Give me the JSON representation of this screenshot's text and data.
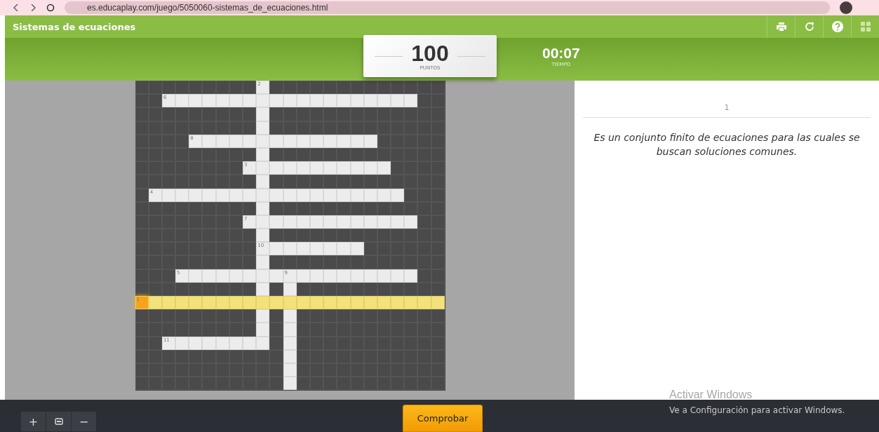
{
  "browser": {
    "url": "es.educaplay.com/juego/5050060-sistemas_de_ecuaciones.html"
  },
  "header": {
    "title": "Sistemas de ecuaciones"
  },
  "score": {
    "value": "100",
    "label": "PUNTOS"
  },
  "timer": {
    "value": "00:07",
    "label": "TIEMPO"
  },
  "grid": {
    "rows": [
      {
        "highlighted": false,
        "cells": [
          {
            "kind": "block"
          },
          {
            "kind": "block"
          },
          {
            "kind": "block"
          },
          {
            "kind": "block"
          },
          {
            "kind": "block"
          },
          {
            "kind": "block"
          },
          {
            "kind": "block"
          },
          {
            "kind": "block"
          },
          {
            "kind": "block"
          },
          {
            "kind": "numbered",
            "number": "2"
          },
          {
            "kind": "block"
          },
          {
            "kind": "block"
          },
          {
            "kind": "block"
          },
          {
            "kind": "block"
          },
          {
            "kind": "block"
          },
          {
            "kind": "block"
          },
          {
            "kind": "block"
          },
          {
            "kind": "block"
          },
          {
            "kind": "block"
          },
          {
            "kind": "block"
          },
          {
            "kind": "block"
          },
          {
            "kind": "block"
          },
          {
            "kind": "block"
          }
        ]
      },
      {
        "highlighted": false,
        "cells": [
          {
            "kind": "block"
          },
          {
            "kind": "block"
          },
          {
            "kind": "numbered",
            "number": "6"
          },
          {
            "kind": "open"
          },
          {
            "kind": "open"
          },
          {
            "kind": "open"
          },
          {
            "kind": "open"
          },
          {
            "kind": "open"
          },
          {
            "kind": "open"
          },
          {
            "kind": "open"
          },
          {
            "kind": "open"
          },
          {
            "kind": "open"
          },
          {
            "kind": "open"
          },
          {
            "kind": "open"
          },
          {
            "kind": "open"
          },
          {
            "kind": "open"
          },
          {
            "kind": "open"
          },
          {
            "kind": "open"
          },
          {
            "kind": "open"
          },
          {
            "kind": "open"
          },
          {
            "kind": "open"
          },
          {
            "kind": "block"
          },
          {
            "kind": "block"
          }
        ]
      },
      {
        "highlighted": false,
        "cells": [
          {
            "kind": "block"
          },
          {
            "kind": "block"
          },
          {
            "kind": "block"
          },
          {
            "kind": "block"
          },
          {
            "kind": "block"
          },
          {
            "kind": "block"
          },
          {
            "kind": "block"
          },
          {
            "kind": "block"
          },
          {
            "kind": "block"
          },
          {
            "kind": "open"
          },
          {
            "kind": "block"
          },
          {
            "kind": "block"
          },
          {
            "kind": "block"
          },
          {
            "kind": "block"
          },
          {
            "kind": "block"
          },
          {
            "kind": "block"
          },
          {
            "kind": "block"
          },
          {
            "kind": "block"
          },
          {
            "kind": "block"
          },
          {
            "kind": "block"
          },
          {
            "kind": "block"
          },
          {
            "kind": "block"
          },
          {
            "kind": "block"
          }
        ]
      },
      {
        "highlighted": false,
        "cells": [
          {
            "kind": "block"
          },
          {
            "kind": "block"
          },
          {
            "kind": "block"
          },
          {
            "kind": "block"
          },
          {
            "kind": "block"
          },
          {
            "kind": "block"
          },
          {
            "kind": "block"
          },
          {
            "kind": "block"
          },
          {
            "kind": "block"
          },
          {
            "kind": "open"
          },
          {
            "kind": "block"
          },
          {
            "kind": "block"
          },
          {
            "kind": "block"
          },
          {
            "kind": "block"
          },
          {
            "kind": "block"
          },
          {
            "kind": "block"
          },
          {
            "kind": "block"
          },
          {
            "kind": "block"
          },
          {
            "kind": "block"
          },
          {
            "kind": "block"
          },
          {
            "kind": "block"
          },
          {
            "kind": "block"
          },
          {
            "kind": "block"
          }
        ]
      },
      {
        "highlighted": false,
        "cells": [
          {
            "kind": "block"
          },
          {
            "kind": "block"
          },
          {
            "kind": "block"
          },
          {
            "kind": "block"
          },
          {
            "kind": "numbered",
            "number": "8"
          },
          {
            "kind": "open"
          },
          {
            "kind": "open"
          },
          {
            "kind": "open"
          },
          {
            "kind": "open"
          },
          {
            "kind": "open"
          },
          {
            "kind": "open"
          },
          {
            "kind": "open"
          },
          {
            "kind": "open"
          },
          {
            "kind": "open"
          },
          {
            "kind": "open"
          },
          {
            "kind": "open"
          },
          {
            "kind": "open"
          },
          {
            "kind": "open"
          },
          {
            "kind": "block"
          },
          {
            "kind": "block"
          },
          {
            "kind": "block"
          },
          {
            "kind": "block"
          },
          {
            "kind": "block"
          }
        ]
      },
      {
        "highlighted": false,
        "cells": [
          {
            "kind": "block"
          },
          {
            "kind": "block"
          },
          {
            "kind": "block"
          },
          {
            "kind": "block"
          },
          {
            "kind": "block"
          },
          {
            "kind": "block"
          },
          {
            "kind": "block"
          },
          {
            "kind": "block"
          },
          {
            "kind": "block"
          },
          {
            "kind": "open"
          },
          {
            "kind": "block"
          },
          {
            "kind": "block"
          },
          {
            "kind": "block"
          },
          {
            "kind": "block"
          },
          {
            "kind": "block"
          },
          {
            "kind": "block"
          },
          {
            "kind": "block"
          },
          {
            "kind": "block"
          },
          {
            "kind": "block"
          },
          {
            "kind": "block"
          },
          {
            "kind": "block"
          },
          {
            "kind": "block"
          },
          {
            "kind": "block"
          }
        ]
      },
      {
        "highlighted": false,
        "cells": [
          {
            "kind": "block"
          },
          {
            "kind": "block"
          },
          {
            "kind": "block"
          },
          {
            "kind": "block"
          },
          {
            "kind": "block"
          },
          {
            "kind": "block"
          },
          {
            "kind": "block"
          },
          {
            "kind": "block"
          },
          {
            "kind": "numbered",
            "number": "3"
          },
          {
            "kind": "open"
          },
          {
            "kind": "open"
          },
          {
            "kind": "open"
          },
          {
            "kind": "open"
          },
          {
            "kind": "open"
          },
          {
            "kind": "open"
          },
          {
            "kind": "open"
          },
          {
            "kind": "open"
          },
          {
            "kind": "open"
          },
          {
            "kind": "open"
          },
          {
            "kind": "block"
          },
          {
            "kind": "block"
          },
          {
            "kind": "block"
          },
          {
            "kind": "block"
          }
        ]
      },
      {
        "highlighted": false,
        "cells": [
          {
            "kind": "block"
          },
          {
            "kind": "block"
          },
          {
            "kind": "block"
          },
          {
            "kind": "block"
          },
          {
            "kind": "block"
          },
          {
            "kind": "block"
          },
          {
            "kind": "block"
          },
          {
            "kind": "block"
          },
          {
            "kind": "block"
          },
          {
            "kind": "open"
          },
          {
            "kind": "block"
          },
          {
            "kind": "block"
          },
          {
            "kind": "block"
          },
          {
            "kind": "block"
          },
          {
            "kind": "block"
          },
          {
            "kind": "block"
          },
          {
            "kind": "block"
          },
          {
            "kind": "block"
          },
          {
            "kind": "block"
          },
          {
            "kind": "block"
          },
          {
            "kind": "block"
          },
          {
            "kind": "block"
          },
          {
            "kind": "block"
          }
        ]
      },
      {
        "highlighted": false,
        "cells": [
          {
            "kind": "block"
          },
          {
            "kind": "numbered",
            "number": "4"
          },
          {
            "kind": "open"
          },
          {
            "kind": "open"
          },
          {
            "kind": "open"
          },
          {
            "kind": "open"
          },
          {
            "kind": "open"
          },
          {
            "kind": "open"
          },
          {
            "kind": "open"
          },
          {
            "kind": "open"
          },
          {
            "kind": "open"
          },
          {
            "kind": "open"
          },
          {
            "kind": "open"
          },
          {
            "kind": "open"
          },
          {
            "kind": "open"
          },
          {
            "kind": "open"
          },
          {
            "kind": "open"
          },
          {
            "kind": "open"
          },
          {
            "kind": "open"
          },
          {
            "kind": "open"
          },
          {
            "kind": "block"
          },
          {
            "kind": "block"
          },
          {
            "kind": "block"
          }
        ]
      },
      {
        "highlighted": false,
        "cells": [
          {
            "kind": "block"
          },
          {
            "kind": "block"
          },
          {
            "kind": "block"
          },
          {
            "kind": "block"
          },
          {
            "kind": "block"
          },
          {
            "kind": "block"
          },
          {
            "kind": "block"
          },
          {
            "kind": "block"
          },
          {
            "kind": "block"
          },
          {
            "kind": "open"
          },
          {
            "kind": "block"
          },
          {
            "kind": "block"
          },
          {
            "kind": "block"
          },
          {
            "kind": "block"
          },
          {
            "kind": "block"
          },
          {
            "kind": "block"
          },
          {
            "kind": "block"
          },
          {
            "kind": "block"
          },
          {
            "kind": "block"
          },
          {
            "kind": "block"
          },
          {
            "kind": "block"
          },
          {
            "kind": "block"
          },
          {
            "kind": "block"
          }
        ]
      },
      {
        "highlighted": false,
        "cells": [
          {
            "kind": "block"
          },
          {
            "kind": "block"
          },
          {
            "kind": "block"
          },
          {
            "kind": "block"
          },
          {
            "kind": "block"
          },
          {
            "kind": "block"
          },
          {
            "kind": "block"
          },
          {
            "kind": "block"
          },
          {
            "kind": "numbered",
            "number": "7"
          },
          {
            "kind": "open"
          },
          {
            "kind": "open"
          },
          {
            "kind": "open"
          },
          {
            "kind": "open"
          },
          {
            "kind": "open"
          },
          {
            "kind": "open"
          },
          {
            "kind": "open"
          },
          {
            "kind": "open"
          },
          {
            "kind": "open"
          },
          {
            "kind": "open"
          },
          {
            "kind": "open"
          },
          {
            "kind": "open"
          },
          {
            "kind": "block"
          },
          {
            "kind": "block"
          }
        ]
      },
      {
        "highlighted": false,
        "cells": [
          {
            "kind": "block"
          },
          {
            "kind": "block"
          },
          {
            "kind": "block"
          },
          {
            "kind": "block"
          },
          {
            "kind": "block"
          },
          {
            "kind": "block"
          },
          {
            "kind": "block"
          },
          {
            "kind": "block"
          },
          {
            "kind": "block"
          },
          {
            "kind": "open"
          },
          {
            "kind": "block"
          },
          {
            "kind": "block"
          },
          {
            "kind": "block"
          },
          {
            "kind": "block"
          },
          {
            "kind": "block"
          },
          {
            "kind": "block"
          },
          {
            "kind": "block"
          },
          {
            "kind": "block"
          },
          {
            "kind": "block"
          },
          {
            "kind": "block"
          },
          {
            "kind": "block"
          },
          {
            "kind": "block"
          },
          {
            "kind": "block"
          }
        ]
      },
      {
        "highlighted": false,
        "cells": [
          {
            "kind": "block"
          },
          {
            "kind": "block"
          },
          {
            "kind": "block"
          },
          {
            "kind": "block"
          },
          {
            "kind": "block"
          },
          {
            "kind": "block"
          },
          {
            "kind": "block"
          },
          {
            "kind": "block"
          },
          {
            "kind": "block"
          },
          {
            "kind": "numbered",
            "number": "10"
          },
          {
            "kind": "open"
          },
          {
            "kind": "open"
          },
          {
            "kind": "open"
          },
          {
            "kind": "open"
          },
          {
            "kind": "open"
          },
          {
            "kind": "open"
          },
          {
            "kind": "open"
          },
          {
            "kind": "block"
          },
          {
            "kind": "block"
          },
          {
            "kind": "block"
          },
          {
            "kind": "block"
          },
          {
            "kind": "block"
          },
          {
            "kind": "block"
          }
        ]
      },
      {
        "highlighted": false,
        "cells": [
          {
            "kind": "block"
          },
          {
            "kind": "block"
          },
          {
            "kind": "block"
          },
          {
            "kind": "block"
          },
          {
            "kind": "block"
          },
          {
            "kind": "block"
          },
          {
            "kind": "block"
          },
          {
            "kind": "block"
          },
          {
            "kind": "block"
          },
          {
            "kind": "open"
          },
          {
            "kind": "block"
          },
          {
            "kind": "block"
          },
          {
            "kind": "block"
          },
          {
            "kind": "block"
          },
          {
            "kind": "block"
          },
          {
            "kind": "block"
          },
          {
            "kind": "block"
          },
          {
            "kind": "block"
          },
          {
            "kind": "block"
          },
          {
            "kind": "block"
          },
          {
            "kind": "block"
          },
          {
            "kind": "block"
          },
          {
            "kind": "block"
          }
        ]
      },
      {
        "highlighted": false,
        "cells": [
          {
            "kind": "block"
          },
          {
            "kind": "block"
          },
          {
            "kind": "block"
          },
          {
            "kind": "numbered",
            "number": "5"
          },
          {
            "kind": "open"
          },
          {
            "kind": "open"
          },
          {
            "kind": "open"
          },
          {
            "kind": "open"
          },
          {
            "kind": "open"
          },
          {
            "kind": "open"
          },
          {
            "kind": "open"
          },
          {
            "kind": "numbered",
            "number": "9"
          },
          {
            "kind": "open"
          },
          {
            "kind": "open"
          },
          {
            "kind": "open"
          },
          {
            "kind": "open"
          },
          {
            "kind": "open"
          },
          {
            "kind": "open"
          },
          {
            "kind": "open"
          },
          {
            "kind": "open"
          },
          {
            "kind": "open"
          },
          {
            "kind": "block"
          },
          {
            "kind": "block"
          }
        ]
      },
      {
        "highlighted": false,
        "cells": [
          {
            "kind": "block"
          },
          {
            "kind": "block"
          },
          {
            "kind": "block"
          },
          {
            "kind": "block"
          },
          {
            "kind": "block"
          },
          {
            "kind": "block"
          },
          {
            "kind": "block"
          },
          {
            "kind": "block"
          },
          {
            "kind": "block"
          },
          {
            "kind": "open"
          },
          {
            "kind": "block"
          },
          {
            "kind": "open"
          },
          {
            "kind": "block"
          },
          {
            "kind": "block"
          },
          {
            "kind": "block"
          },
          {
            "kind": "block"
          },
          {
            "kind": "block"
          },
          {
            "kind": "block"
          },
          {
            "kind": "block"
          },
          {
            "kind": "block"
          },
          {
            "kind": "block"
          },
          {
            "kind": "block"
          },
          {
            "kind": "block"
          }
        ]
      },
      {
        "highlighted": true,
        "cells": [
          {
            "kind": "active",
            "number": "1"
          },
          {
            "kind": "open"
          },
          {
            "kind": "open"
          },
          {
            "kind": "open"
          },
          {
            "kind": "open"
          },
          {
            "kind": "open"
          },
          {
            "kind": "open"
          },
          {
            "kind": "open"
          },
          {
            "kind": "open"
          },
          {
            "kind": "open"
          },
          {
            "kind": "open"
          },
          {
            "kind": "open"
          },
          {
            "kind": "open"
          },
          {
            "kind": "open"
          },
          {
            "kind": "open"
          },
          {
            "kind": "open"
          },
          {
            "kind": "open"
          },
          {
            "kind": "open"
          },
          {
            "kind": "open"
          },
          {
            "kind": "open"
          },
          {
            "kind": "open"
          },
          {
            "kind": "open"
          },
          {
            "kind": "open"
          }
        ]
      },
      {
        "highlighted": false,
        "cells": [
          {
            "kind": "block"
          },
          {
            "kind": "block"
          },
          {
            "kind": "block"
          },
          {
            "kind": "block"
          },
          {
            "kind": "block"
          },
          {
            "kind": "block"
          },
          {
            "kind": "block"
          },
          {
            "kind": "block"
          },
          {
            "kind": "block"
          },
          {
            "kind": "open"
          },
          {
            "kind": "block"
          },
          {
            "kind": "open"
          },
          {
            "kind": "block"
          },
          {
            "kind": "block"
          },
          {
            "kind": "block"
          },
          {
            "kind": "block"
          },
          {
            "kind": "block"
          },
          {
            "kind": "block"
          },
          {
            "kind": "block"
          },
          {
            "kind": "block"
          },
          {
            "kind": "block"
          },
          {
            "kind": "block"
          },
          {
            "kind": "block"
          }
        ]
      },
      {
        "highlighted": false,
        "cells": [
          {
            "kind": "block"
          },
          {
            "kind": "block"
          },
          {
            "kind": "block"
          },
          {
            "kind": "block"
          },
          {
            "kind": "block"
          },
          {
            "kind": "block"
          },
          {
            "kind": "block"
          },
          {
            "kind": "block"
          },
          {
            "kind": "block"
          },
          {
            "kind": "open"
          },
          {
            "kind": "block"
          },
          {
            "kind": "open"
          },
          {
            "kind": "block"
          },
          {
            "kind": "block"
          },
          {
            "kind": "block"
          },
          {
            "kind": "block"
          },
          {
            "kind": "block"
          },
          {
            "kind": "block"
          },
          {
            "kind": "block"
          },
          {
            "kind": "block"
          },
          {
            "kind": "block"
          },
          {
            "kind": "block"
          },
          {
            "kind": "block"
          }
        ]
      },
      {
        "highlighted": false,
        "cells": [
          {
            "kind": "block"
          },
          {
            "kind": "block"
          },
          {
            "kind": "numbered",
            "number": "11"
          },
          {
            "kind": "open"
          },
          {
            "kind": "open"
          },
          {
            "kind": "open"
          },
          {
            "kind": "open"
          },
          {
            "kind": "open"
          },
          {
            "kind": "open"
          },
          {
            "kind": "open"
          },
          {
            "kind": "block"
          },
          {
            "kind": "open"
          },
          {
            "kind": "block"
          },
          {
            "kind": "block"
          },
          {
            "kind": "block"
          },
          {
            "kind": "block"
          },
          {
            "kind": "block"
          },
          {
            "kind": "block"
          },
          {
            "kind": "block"
          },
          {
            "kind": "block"
          },
          {
            "kind": "block"
          },
          {
            "kind": "block"
          },
          {
            "kind": "block"
          }
        ]
      },
      {
        "highlighted": false,
        "cells": [
          {
            "kind": "block"
          },
          {
            "kind": "block"
          },
          {
            "kind": "block"
          },
          {
            "kind": "block"
          },
          {
            "kind": "block"
          },
          {
            "kind": "block"
          },
          {
            "kind": "block"
          },
          {
            "kind": "block"
          },
          {
            "kind": "block"
          },
          {
            "kind": "block"
          },
          {
            "kind": "block"
          },
          {
            "kind": "open"
          },
          {
            "kind": "block"
          },
          {
            "kind": "block"
          },
          {
            "kind": "block"
          },
          {
            "kind": "block"
          },
          {
            "kind": "block"
          },
          {
            "kind": "block"
          },
          {
            "kind": "block"
          },
          {
            "kind": "block"
          },
          {
            "kind": "block"
          },
          {
            "kind": "block"
          },
          {
            "kind": "block"
          }
        ]
      },
      {
        "highlighted": false,
        "cells": [
          {
            "kind": "block"
          },
          {
            "kind": "block"
          },
          {
            "kind": "block"
          },
          {
            "kind": "block"
          },
          {
            "kind": "block"
          },
          {
            "kind": "block"
          },
          {
            "kind": "block"
          },
          {
            "kind": "block"
          },
          {
            "kind": "block"
          },
          {
            "kind": "block"
          },
          {
            "kind": "block"
          },
          {
            "kind": "open"
          },
          {
            "kind": "block"
          },
          {
            "kind": "block"
          },
          {
            "kind": "block"
          },
          {
            "kind": "block"
          },
          {
            "kind": "block"
          },
          {
            "kind": "block"
          },
          {
            "kind": "block"
          },
          {
            "kind": "block"
          },
          {
            "kind": "block"
          },
          {
            "kind": "block"
          },
          {
            "kind": "block"
          }
        ]
      },
      {
        "highlighted": false,
        "cells": [
          {
            "kind": "block"
          },
          {
            "kind": "block"
          },
          {
            "kind": "block"
          },
          {
            "kind": "block"
          },
          {
            "kind": "block"
          },
          {
            "kind": "block"
          },
          {
            "kind": "block"
          },
          {
            "kind": "block"
          },
          {
            "kind": "block"
          },
          {
            "kind": "block"
          },
          {
            "kind": "block"
          },
          {
            "kind": "open"
          },
          {
            "kind": "block"
          },
          {
            "kind": "block"
          },
          {
            "kind": "block"
          },
          {
            "kind": "block"
          },
          {
            "kind": "block"
          },
          {
            "kind": "block"
          },
          {
            "kind": "block"
          },
          {
            "kind": "block"
          },
          {
            "kind": "block"
          },
          {
            "kind": "block"
          },
          {
            "kind": "block"
          }
        ]
      }
    ]
  },
  "clue": {
    "number": "1",
    "text": "Es un conjunto finito de ecuaciones para las cuales se buscan soluciones comunes."
  },
  "zoom_controls": {
    "zoom_in": "+",
    "zoom_out": "−"
  },
  "check_button": "Comprobar",
  "os_notice": {
    "title": "Activar Windows",
    "text": "Ve a Configuración para activar Windows."
  }
}
